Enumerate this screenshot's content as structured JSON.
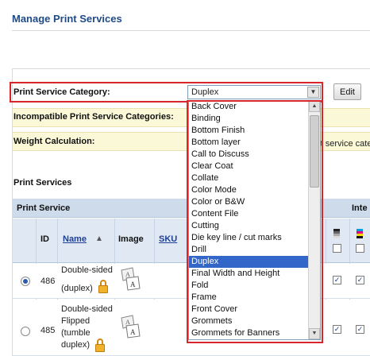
{
  "page": {
    "title": "Manage Print Services"
  },
  "category": {
    "label": "Print Service Category:",
    "selected": "Duplex",
    "edit_label": "Edit",
    "options": [
      "Back Cover",
      "Binding",
      "Bottom Finish",
      "Bottom layer",
      "Call to Discuss",
      "Clear Coat",
      "Collate",
      "Color Mode",
      "Color or B&W",
      "Content File",
      "Cutting",
      "Die key line / cut marks",
      "Drill",
      "Duplex",
      "Final Width and Height",
      "Fold",
      "Frame",
      "Front Cover",
      "Grommets",
      "Grommets for Banners"
    ]
  },
  "incompatible": {
    "label": "Incompatible Print Service Categories:"
  },
  "weight": {
    "label": "Weight Calculation:",
    "hint": "rt service cate"
  },
  "section": {
    "title": "Print Services"
  },
  "table": {
    "group_header": "Print Service",
    "group_header_right": "Inte",
    "columns": {
      "id": "ID",
      "name": "Name",
      "image": "Image",
      "sku": "SKU"
    },
    "rows": [
      {
        "id": "486",
        "name_line1": "Double-sided",
        "name_line2": "(duplex)",
        "selected": true
      },
      {
        "id": "485",
        "name_line1": "Double-sided",
        "name_line2": "Flipped",
        "name_line3": "(tumble",
        "name_line4": "duplex)",
        "selected": false
      }
    ]
  },
  "colors": {
    "highlight": "#d8262d",
    "selection": "#3267c9",
    "title": "#1f4a86",
    "row_bg": "#fbf8d7",
    "header_bg": "#cddbeb"
  }
}
